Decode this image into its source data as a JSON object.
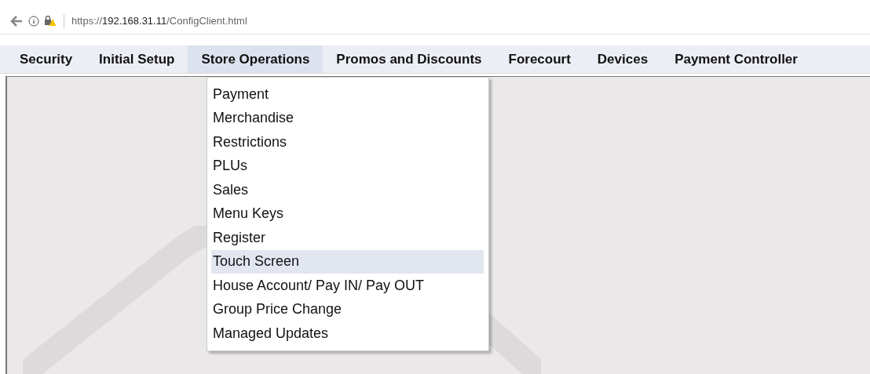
{
  "address_bar": {
    "scheme": "https://",
    "host": "192.168.31.11",
    "path": "/ConfigClient.html"
  },
  "menu": [
    {
      "label": "Security",
      "selected": false
    },
    {
      "label": "Initial Setup",
      "selected": false
    },
    {
      "label": "Store Operations",
      "selected": true
    },
    {
      "label": "Promos and Discounts",
      "selected": false
    },
    {
      "label": "Forecourt",
      "selected": false
    },
    {
      "label": "Devices",
      "selected": false
    },
    {
      "label": "Payment Controller",
      "selected": false
    }
  ],
  "dropdown": [
    {
      "label": "Payment",
      "selected": false
    },
    {
      "label": "Merchandise",
      "selected": false
    },
    {
      "label": "Restrictions",
      "selected": false
    },
    {
      "label": "PLUs",
      "selected": false
    },
    {
      "label": "Sales",
      "selected": false
    },
    {
      "label": "Menu Keys",
      "selected": false
    },
    {
      "label": "Register",
      "selected": false
    },
    {
      "label": "Touch Screen",
      "selected": true
    },
    {
      "label": "House Account/ Pay IN/ Pay OUT",
      "selected": false
    },
    {
      "label": "Group Price Change",
      "selected": false
    },
    {
      "label": "Managed Updates",
      "selected": false
    }
  ]
}
